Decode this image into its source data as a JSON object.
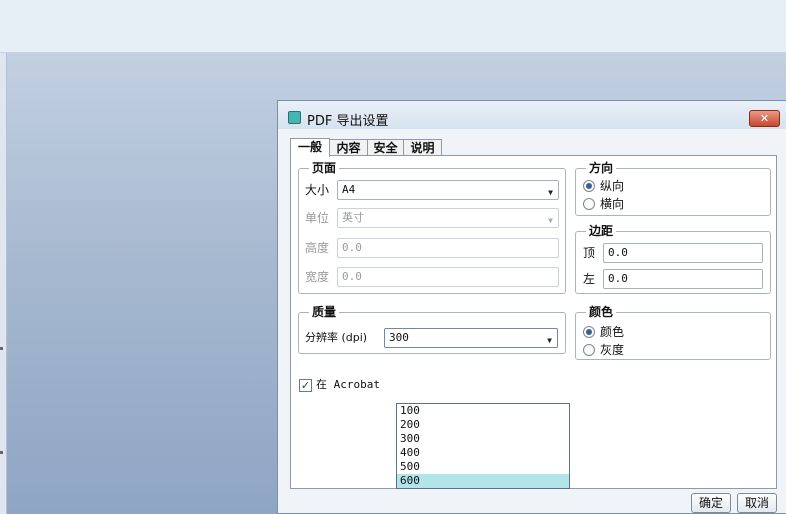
{
  "window": {
    "title": "PDF 导出设置",
    "close_label": "✕"
  },
  "tabs": [
    {
      "label": "一般",
      "active": true
    },
    {
      "label": "内容",
      "active": false
    },
    {
      "label": "安全",
      "active": false
    },
    {
      "label": "说明",
      "active": false
    }
  ],
  "page_group": {
    "title": "页面",
    "size_label": "大小",
    "size_value": "A4",
    "unit_label": "单位",
    "unit_value": "英寸",
    "height_label": "高度",
    "height_value": "0.0",
    "width_label": "宽度",
    "width_value": "0.0"
  },
  "orientation_group": {
    "title": "方向",
    "portrait_label": "纵向",
    "landscape_label": "横向",
    "selected": "portrait"
  },
  "margin_group": {
    "title": "边距",
    "top_label": "顶",
    "top_value": "0.0",
    "left_label": "左",
    "left_value": "0.0"
  },
  "quality_group": {
    "title": "质量",
    "resolution_label": "分辨率 (dpi)",
    "resolution_value": "300",
    "options": [
      "100",
      "200",
      "300",
      "400",
      "500",
      "600"
    ],
    "highlighted_option": "600"
  },
  "color_group": {
    "title": "颜色",
    "color_label": "颜色",
    "gray_label": "灰度",
    "selected": "color"
  },
  "acrobat_check": {
    "label": "在 Acrobat",
    "checked": true
  },
  "buttons": {
    "ok_label": "确定",
    "cancel_label": "取消"
  },
  "colors": {
    "dropdown_highlight": "#b3e4ea",
    "close_button": "#c9482f",
    "title_icon": "#44b7b3"
  }
}
